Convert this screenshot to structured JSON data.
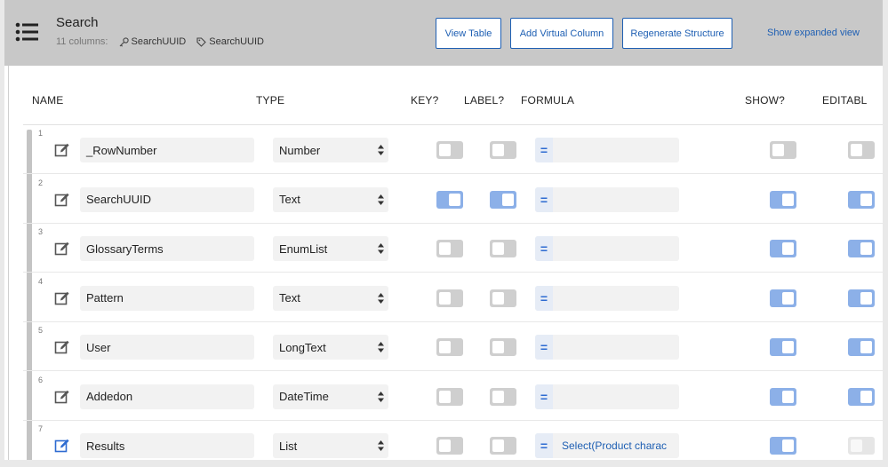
{
  "header": {
    "title": "Search",
    "columns_count": "11 columns:",
    "key_column": "SearchUUID",
    "label_column": "SearchUUID",
    "view_table_label": "View Table",
    "add_virtual_column_label": "Add Virtual Column",
    "regenerate_label": "Regenerate Structure",
    "expanded_view_label": "Show expanded view"
  },
  "table": {
    "columns": {
      "name": "NAME",
      "type": "TYPE",
      "key": "KEY?",
      "label": "LABEL?",
      "formula": "FORMULA",
      "show": "SHOW?",
      "editable": "EDITABL"
    },
    "rows": [
      {
        "num": "1",
        "name": "_RowNumber",
        "type": "Number",
        "key": false,
        "label": false,
        "formula": "",
        "show": false,
        "editable": false
      },
      {
        "num": "2",
        "name": "SearchUUID",
        "type": "Text",
        "key": true,
        "label": true,
        "formula": "",
        "show": true,
        "editable": true
      },
      {
        "num": "3",
        "name": "GlossaryTerms",
        "type": "EnumList",
        "key": false,
        "label": false,
        "formula": "",
        "show": true,
        "editable": true
      },
      {
        "num": "4",
        "name": "Pattern",
        "type": "Text",
        "key": false,
        "label": false,
        "formula": "",
        "show": true,
        "editable": true
      },
      {
        "num": "5",
        "name": "User",
        "type": "LongText",
        "key": false,
        "label": false,
        "formula": "",
        "show": true,
        "editable": true
      },
      {
        "num": "6",
        "name": "Addedon",
        "type": "DateTime",
        "key": false,
        "label": false,
        "formula": "",
        "show": true,
        "editable": true
      },
      {
        "num": "7",
        "name": "Results",
        "type": "List",
        "key": false,
        "label": false,
        "formula": "Select(Product charac",
        "show": true,
        "editable": false
      }
    ]
  },
  "colors": {
    "accent": "#1e5fb3",
    "toggle_on": "#8cb0e8",
    "toggle_off": "#cfcfcf",
    "header_bg": "#c8c8c8"
  },
  "icons": {
    "table": "list-icon",
    "edit": "edit-icon",
    "key": "key-icon",
    "label": "tag-icon",
    "select": "sort-arrows-icon"
  }
}
